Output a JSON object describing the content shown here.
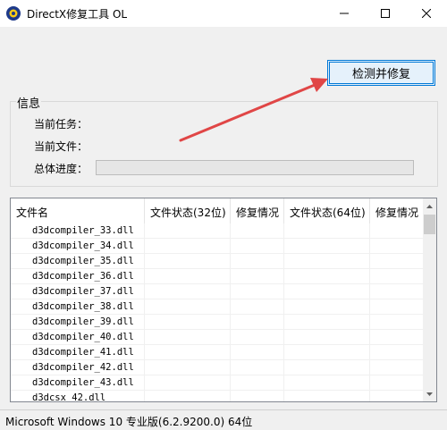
{
  "window": {
    "title": "DirectX修复工具 OL"
  },
  "toolbar": {
    "check_button_label": "检测并修复"
  },
  "info": {
    "group_label": "信息",
    "current_task_label": "当前任务：",
    "current_file_label": "当前文件：",
    "total_progress_label": "总体进度：",
    "progress": 0
  },
  "table": {
    "columns": [
      "文件名",
      "文件状态(32位)",
      "修复情况",
      "文件状态(64位)",
      "修复情况"
    ],
    "rows": [
      {
        "name": "d3dcompiler_33.dll"
      },
      {
        "name": "d3dcompiler_34.dll"
      },
      {
        "name": "d3dcompiler_35.dll"
      },
      {
        "name": "d3dcompiler_36.dll"
      },
      {
        "name": "d3dcompiler_37.dll"
      },
      {
        "name": "d3dcompiler_38.dll"
      },
      {
        "name": "d3dcompiler_39.dll"
      },
      {
        "name": "d3dcompiler_40.dll"
      },
      {
        "name": "d3dcompiler_41.dll"
      },
      {
        "name": "d3dcompiler_42.dll"
      },
      {
        "name": "d3dcompiler_43.dll"
      },
      {
        "name": "d3dcsx_42.dll"
      }
    ]
  },
  "status_bar": {
    "text": "Microsoft Windows 10 专业版(6.2.9200.0) 64位"
  },
  "colors": {
    "annotation_arrow": "#e04646",
    "button_border": "#0078d7",
    "button_bg": "#e5f1fb"
  },
  "icons": [
    "app-icon",
    "minimize-icon",
    "maximize-icon",
    "close-icon",
    "scroll-up-icon",
    "scroll-down-icon"
  ]
}
